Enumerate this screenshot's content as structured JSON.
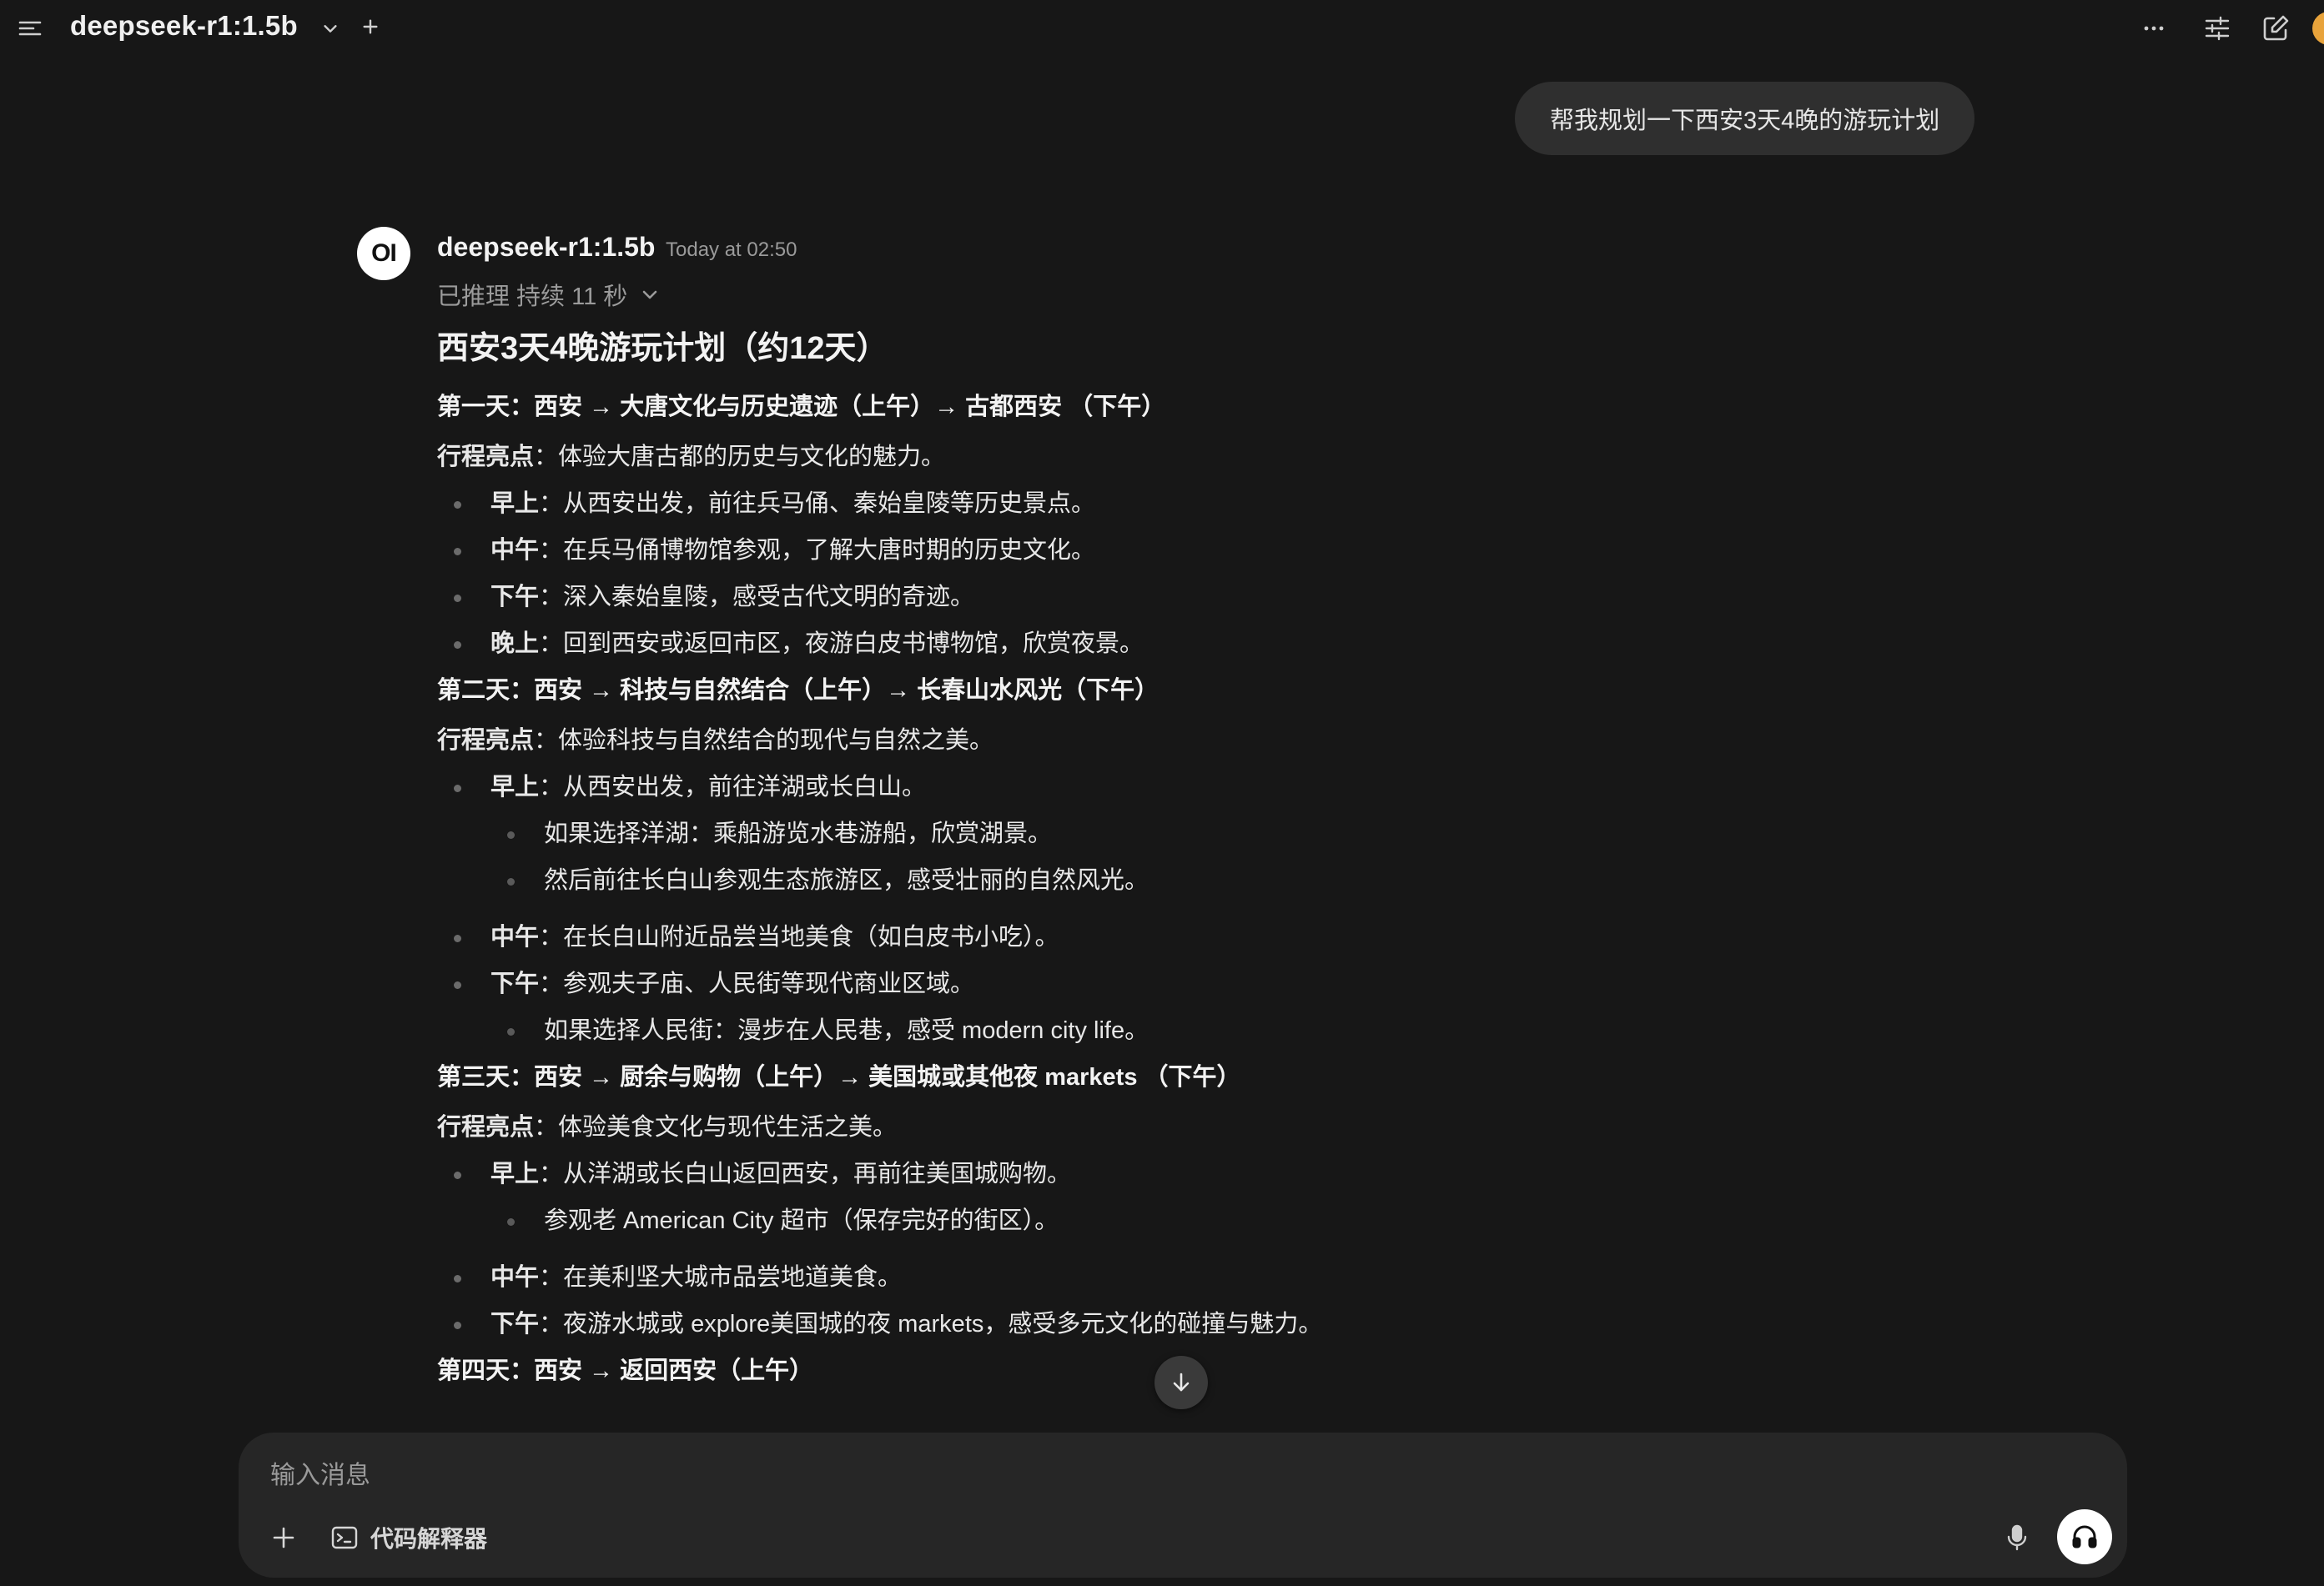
{
  "header": {
    "model_name": "deepseek-r1:1.5b",
    "icons": {
      "menu": "menu-icon",
      "model_dropdown": "chevron-down-icon",
      "add_model": "plus-icon",
      "more": "ellipsis-icon",
      "controls": "sliders-icon",
      "new_chat": "edit-icon"
    }
  },
  "user_message": {
    "text": "帮我规划一下西安3天4晚的游玩计划"
  },
  "assistant": {
    "logo_text": "OI",
    "name": "deepseek-r1:1.5b",
    "timestamp": "Today at 02:50",
    "reasoning_label": "已推理 持续 11 秒",
    "title": "西安3天4晚游玩计划（约12天）",
    "days": [
      {
        "heading": "第一天：西安 → 大唐文化与历史遗迹（上午）→ 古都西安 （下午）",
        "highlight_label": "行程亮点",
        "highlight_text": "：体验大唐古都的历史与文化的魅力。",
        "items": [
          {
            "label": "早上",
            "text": "：从西安出发，前往兵马俑、秦始皇陵等历史景点。"
          },
          {
            "label": "中午",
            "text": "：在兵马俑博物馆参观，了解大唐时期的历史文化。"
          },
          {
            "label": "下午",
            "text": "：深入秦始皇陵，感受古代文明的奇迹。"
          },
          {
            "label": "晚上",
            "text": "：回到西安或返回市区，夜游白皮书博物馆，欣赏夜景。"
          }
        ]
      },
      {
        "heading": "第二天：西安 → 科技与自然结合（上午）→ 长春山水风光（下午）",
        "highlight_label": "行程亮点",
        "highlight_text": "：体验科技与自然结合的现代与自然之美。",
        "items": [
          {
            "label": "早上",
            "text": "：从西安出发，前往洋湖或长白山。",
            "sub": [
              "如果选择洋湖：乘船游览水巷游船，欣赏湖景。",
              "然后前往长白山参观生态旅游区，感受壮丽的自然风光。"
            ]
          },
          {
            "label": "中午",
            "text": "：在长白山附近品尝当地美食（如白皮书小吃）。"
          },
          {
            "label": "下午",
            "text": "：参观夫子庙、人民街等现代商业区域。",
            "sub": [
              "如果选择人民街：漫步在人民巷，感受 modern city life。"
            ]
          }
        ]
      },
      {
        "heading": "第三天：西安 → 厨余与购物（上午）→ 美国城或其他夜 markets （下午）",
        "highlight_label": "行程亮点",
        "highlight_text": "：体验美食文化与现代生活之美。",
        "items": [
          {
            "label": "早上",
            "text": "：从洋湖或长白山返回西安，再前往美国城购物。",
            "sub": [
              "参观老 American City 超市（保存完好的街区）。"
            ]
          },
          {
            "label": "中午",
            "text": "：在美利坚大城市品尝地道美食。"
          },
          {
            "label": "下午",
            "text": "：夜游水城或 explore美国城的夜 markets，感受多元文化的碰撞与魅力。"
          }
        ]
      },
      {
        "heading": "第四天：西安 → 返回西安（上午）"
      }
    ]
  },
  "composer": {
    "placeholder": "输入消息",
    "value": "",
    "code_interpreter_label": "代码解释器",
    "icons": {
      "add": "plus-icon",
      "code_interpreter": "terminal-icon",
      "mic": "microphone-icon",
      "voice": "headphones-icon",
      "scroll": "arrow-down-icon"
    }
  }
}
